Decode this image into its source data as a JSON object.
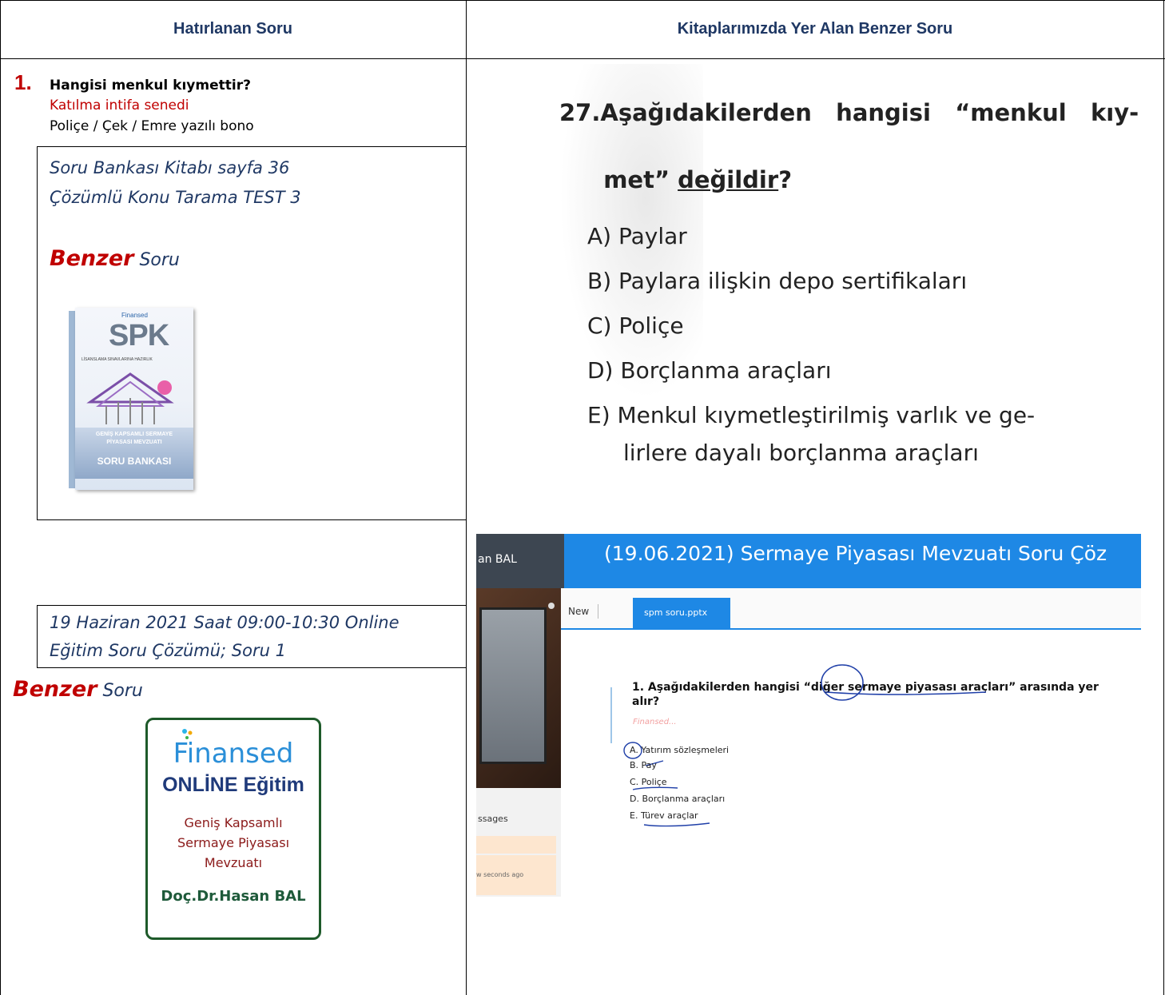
{
  "headers": {
    "left": "Hatırlanan Soru",
    "right": "Kitaplarımızda Yer Alan Benzer Soru"
  },
  "left": {
    "q_number": "1.",
    "q_title": "Hangisi menkul kıymettir?",
    "answer_red": "Katılma intifa senedi",
    "answer_list": "Poliçe / Çek / Emre yazılı bono",
    "book_ref_line1": "Soru Bankası Kitabı sayfa 36",
    "book_ref_line2": "Çözümlü Konu Tarama TEST 3",
    "benzer_bold": "Benzer",
    "benzer_rest": " Soru",
    "book_cover": {
      "brand": "Finansed",
      "title": "SPK",
      "subtitle": "LİSANSLAMA SINAVLARINA HAZIRLIK",
      "band_line1": "GENİŞ KAPSAMLI SERMAYE",
      "band_line2": "PİYASASI MEVZUATI",
      "band_line3": "SORU BANKASI"
    },
    "online_ref_line1": "19 Haziran 2021 Saat 09:00-10:30 Online",
    "online_ref_line2": "Eğitim Soru Çözümü; Soru 1",
    "benzer2_bold": "Benzer",
    "benzer2_rest": " Soru",
    "online_card": {
      "brand": "Finansed",
      "title": "ONLİNE Eğitim",
      "line1": "Geniş Kapsamlı",
      "line2": "Sermaye Piyasası",
      "line3": "Mevzuatı",
      "author": "Doç.Dr.Hasan BAL"
    }
  },
  "right": {
    "question_line1": "27.Aşağıdakilerden   hangisi   “menkul   kıy-",
    "question_line2_a": "met” ",
    "question_line2_u": "değildir",
    "question_line2_b": "?",
    "options": [
      "A) Paylar",
      "B) Paylara ilişkin depo sertifikaları",
      "C) Poliçe",
      "D) Borçlanma araçları",
      "E) Menkul kıymetleştirilmiş varlık ve ge-",
      "lirlere dayalı borçlanma araçları"
    ],
    "screenshot": {
      "name": "an BAL",
      "title": "(19.06.2021) Sermaye Piyasası Mevzuatı Soru Çöz",
      "tab_new": "New",
      "tab_file": "spm soru.pptx",
      "q_line1": "1. Aşağıdakilerden hangisi “diğer sermaye piyasası araçları” arasında yer",
      "q_line2": "alır?",
      "watermark": "Finansed...",
      "opts": [
        "A.  Yatırım sözleşmeleri",
        "B.  Pay",
        "C.  Poliçe",
        "D.  Borçlanma araçları",
        "E.  Türev araçlar"
      ],
      "side_messages": "ssages",
      "side_time": "w seconds ago"
    }
  }
}
